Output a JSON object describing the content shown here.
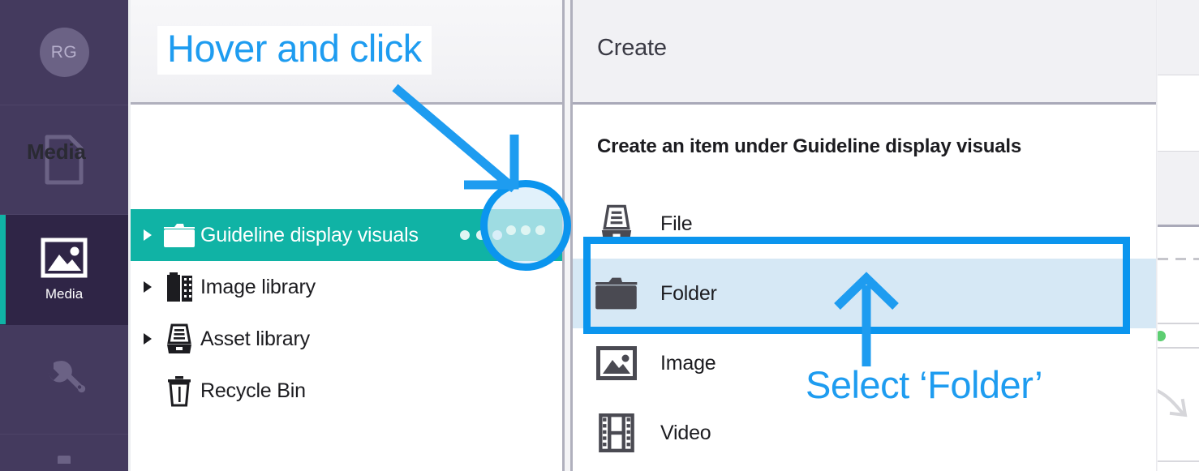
{
  "app": {
    "accent_teal": "#10b3a5",
    "annotation_blue": "#1e9cf0",
    "rail_purple": "#443a5e",
    "rail_active_purple": "#2f2546",
    "hover_blue": "#d6e8f5"
  },
  "rail": {
    "avatar_initials": "RG",
    "items": [
      {
        "name": "content",
        "icon": "document-icon",
        "label": ""
      },
      {
        "name": "media",
        "icon": "image-icon",
        "label": "Media",
        "active": true
      },
      {
        "name": "settings",
        "icon": "wrench-icon",
        "label": ""
      }
    ]
  },
  "tree_panel": {
    "title": "Media",
    "items": [
      {
        "label": "Guideline display visuals",
        "icon": "folder-icon",
        "caret": true,
        "selected": true,
        "kebab": "ellipsis-icon"
      },
      {
        "label": "Image library",
        "icon": "film-roll-icon",
        "caret": true,
        "selected": false
      },
      {
        "label": "Asset library",
        "icon": "file-cabinet-icon",
        "caret": true,
        "selected": false
      },
      {
        "label": "Recycle Bin",
        "icon": "trash-icon",
        "caret": false,
        "selected": false
      }
    ]
  },
  "create_panel": {
    "header_title": "Create",
    "subtitle": "Create an item under Guideline display visuals",
    "options": [
      {
        "label": "File",
        "icon": "file-cabinet-icon",
        "hovered": false
      },
      {
        "label": "Folder",
        "icon": "folder-icon",
        "hovered": true
      },
      {
        "label": "Image",
        "icon": "image-icon",
        "hovered": false
      },
      {
        "label": "Video",
        "icon": "film-strip-icon",
        "hovered": false
      }
    ]
  },
  "annotations": [
    {
      "name": "hover-and-click-callout",
      "text": "Hover and click"
    },
    {
      "name": "select-folder-callout",
      "text": "Select ‘Folder’"
    }
  ]
}
